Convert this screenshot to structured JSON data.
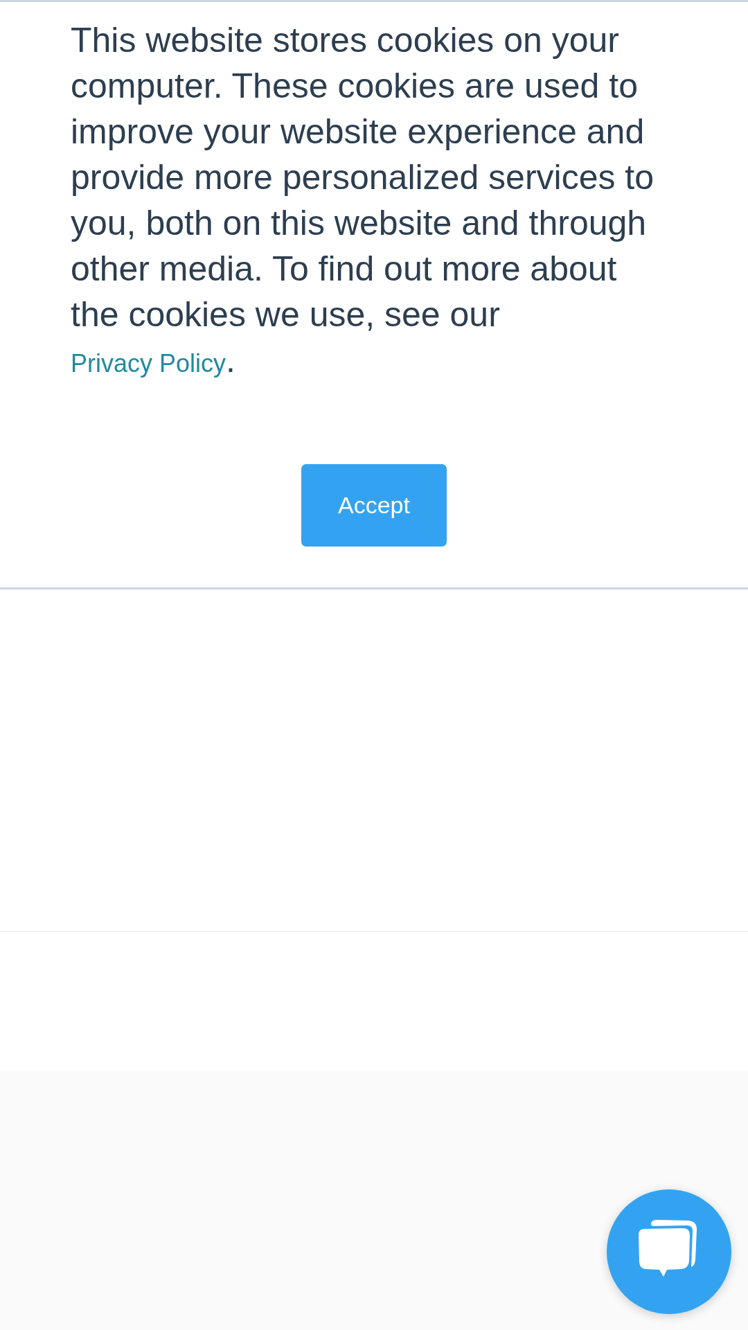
{
  "cookie_banner": {
    "message": "This website stores cookies on your computer. These cookies are used to improve your website experience and provide more personalized services to you, both on this website and through other media. To find out more about the cookies we use, see our",
    "link": "Privacy Policy",
    "after_link": ".",
    "button": "Accept"
  }
}
